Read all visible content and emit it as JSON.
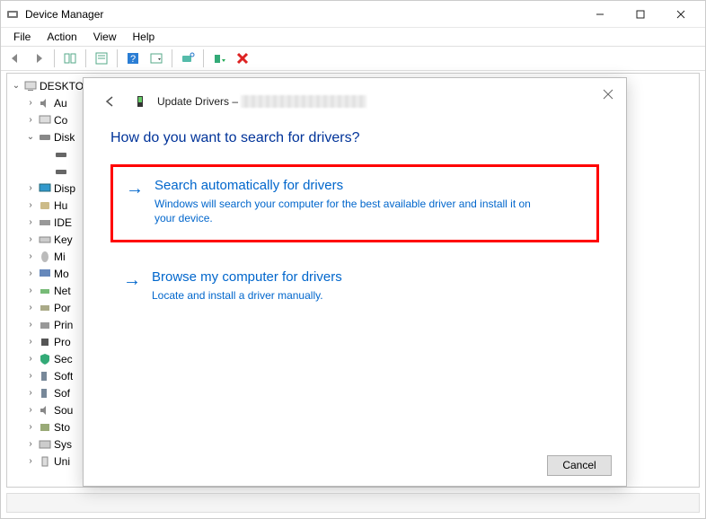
{
  "window": {
    "title": "Device Manager"
  },
  "menubar": {
    "file": "File",
    "action": "Action",
    "view": "View",
    "help": "Help"
  },
  "tree": {
    "root": "DESKTO",
    "items": [
      {
        "label": "Au",
        "icon": "audio-icon"
      },
      {
        "label": "Co",
        "icon": "computer-icon"
      },
      {
        "label": "Disk",
        "icon": "disk-icon",
        "expanded": true,
        "children": 2
      },
      {
        "label": "Disp",
        "icon": "display-icon"
      },
      {
        "label": "Hu",
        "icon": "hid-icon"
      },
      {
        "label": "IDE",
        "icon": "ide-icon"
      },
      {
        "label": "Key",
        "icon": "keyboard-icon"
      },
      {
        "label": "Mi",
        "icon": "mouse-icon"
      },
      {
        "label": "Mo",
        "icon": "monitor-icon"
      },
      {
        "label": "Net",
        "icon": "network-icon"
      },
      {
        "label": "Por",
        "icon": "port-icon"
      },
      {
        "label": "Prin",
        "icon": "printer-icon"
      },
      {
        "label": "Pro",
        "icon": "processor-icon"
      },
      {
        "label": "Sec",
        "icon": "security-icon"
      },
      {
        "label": "Soft",
        "icon": "software-icon"
      },
      {
        "label": "Sof",
        "icon": "software-icon"
      },
      {
        "label": "Sou",
        "icon": "sound-icon"
      },
      {
        "label": "Sto",
        "icon": "storage-icon"
      },
      {
        "label": "Sys",
        "icon": "system-icon"
      },
      {
        "label": "Uni",
        "icon": "usb-icon"
      }
    ]
  },
  "dialog": {
    "title_prefix": "Update Drivers – ",
    "question": "How do you want to search for drivers?",
    "option1": {
      "title": "Search automatically for drivers",
      "desc": "Windows will search your computer for the best available driver and install it on your device."
    },
    "option2": {
      "title": "Browse my computer for drivers",
      "desc": "Locate and install a driver manually."
    },
    "cancel": "Cancel"
  }
}
